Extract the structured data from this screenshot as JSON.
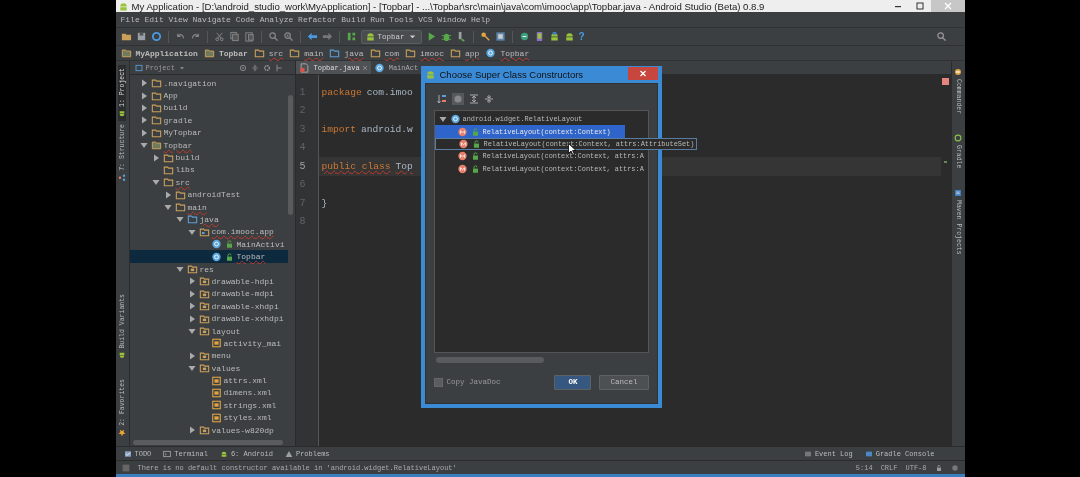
{
  "window": {
    "title": "My Application - [D:\\android_studio_work\\MyApplication] - [Topbar] - ...\\Topbar\\src\\main\\java\\com\\imooc\\app\\Topbar.java - Android Studio (Beta) 0.8.9"
  },
  "menu_titles": [
    "File",
    "Edit",
    "View",
    "Navigate",
    "Code",
    "Analyze",
    "Refactor",
    "Build",
    "Run",
    "Tools",
    "VCS",
    "Window",
    "Help"
  ],
  "toolbar": {
    "run_config": "Topbar",
    "help": "?"
  },
  "breadcrumbs": [
    {
      "label": "MyApplication",
      "kind": "module",
      "error": false
    },
    {
      "label": "Topbar",
      "kind": "module",
      "error": false
    },
    {
      "label": "src",
      "kind": "folder",
      "error": true
    },
    {
      "label": "main",
      "kind": "folder",
      "error": true
    },
    {
      "label": "java",
      "kind": "source",
      "error": true
    },
    {
      "label": "com",
      "kind": "folder",
      "error": true
    },
    {
      "label": "imooc",
      "kind": "folder",
      "error": true
    },
    {
      "label": "app",
      "kind": "folder",
      "error": true
    },
    {
      "label": "Topbar",
      "kind": "class",
      "error": true
    }
  ],
  "side_tabs_left": {
    "top": [
      {
        "label": "1: Project",
        "selected": true,
        "kind": "android"
      },
      {
        "label": "7: Structure",
        "selected": false,
        "kind": "structure"
      }
    ],
    "bottom": [
      {
        "label": "Build Variants",
        "selected": false,
        "kind": "android"
      },
      {
        "label": "2: Favorites",
        "selected": false,
        "kind": "star"
      }
    ]
  },
  "project_panel": {
    "title": "Project",
    "tree": [
      {
        "label": ".navigation",
        "kind": "folder",
        "expanded": false,
        "selected": false,
        "error": false
      },
      {
        "label": "App",
        "kind": "folder",
        "expanded": false,
        "selected": false,
        "error": false
      },
      {
        "label": "build",
        "kind": "folder",
        "expanded": false,
        "selected": false,
        "error": false
      },
      {
        "label": "gradle",
        "kind": "folder",
        "expanded": false,
        "selected": false,
        "error": false
      },
      {
        "label": "MyTopbar",
        "kind": "folder",
        "expanded": false,
        "selected": false,
        "error": false
      },
      {
        "label": "Topbar",
        "kind": "module",
        "expanded": true,
        "selected": false,
        "error": true,
        "children": [
          {
            "label": "build",
            "kind": "folder",
            "expanded": false,
            "selected": false,
            "error": false
          },
          {
            "label": "libs",
            "kind": "folder",
            "selected": false,
            "error": false
          },
          {
            "label": "src",
            "kind": "folder",
            "expanded": true,
            "selected": false,
            "error": true,
            "children": [
              {
                "label": "androidTest",
                "kind": "folder",
                "expanded": false,
                "selected": false,
                "error": false
              },
              {
                "label": "main",
                "kind": "folder",
                "expanded": true,
                "selected": false,
                "error": true,
                "children": [
                  {
                    "label": "java",
                    "kind": "source",
                    "expanded": true,
                    "selected": false,
                    "error": true,
                    "children": [
                      {
                        "label": "com.imooc.app",
                        "kind": "package",
                        "expanded": true,
                        "selected": false,
                        "error": true,
                        "children": [
                          {
                            "label": "MainActivi",
                            "kind": "class",
                            "selected": false,
                            "error": false
                          },
                          {
                            "label": "Topbar",
                            "kind": "class",
                            "selected": true,
                            "error": true
                          }
                        ]
                      }
                    ]
                  },
                  {
                    "label": "res",
                    "kind": "resource",
                    "expanded": true,
                    "selected": false,
                    "error": false,
                    "children": [
                      {
                        "label": "drawable-hdpi",
                        "kind": "resource",
                        "expanded": false,
                        "selected": false,
                        "error": false
                      },
                      {
                        "label": "drawable-mdpi",
                        "kind": "resource",
                        "expanded": false,
                        "selected": false,
                        "error": false
                      },
                      {
                        "label": "drawable-xhdpi",
                        "kind": "resource",
                        "expanded": false,
                        "selected": false,
                        "error": false
                      },
                      {
                        "label": "drawable-xxhdpi",
                        "kind": "resource",
                        "expanded": false,
                        "selected": false,
                        "error": false
                      },
                      {
                        "label": "layout",
                        "kind": "resource",
                        "expanded": true,
                        "selected": false,
                        "error": false,
                        "children": [
                          {
                            "label": "activity_mai",
                            "kind": "xml",
                            "selected": false,
                            "error": false
                          }
                        ]
                      },
                      {
                        "label": "menu",
                        "kind": "resource",
                        "expanded": false,
                        "selected": false,
                        "error": false
                      },
                      {
                        "label": "values",
                        "kind": "resource",
                        "expanded": true,
                        "selected": false,
                        "error": false,
                        "children": [
                          {
                            "label": "attrs.xml",
                            "kind": "xml",
                            "selected": false,
                            "error": false
                          },
                          {
                            "label": "dimens.xml",
                            "kind": "xml",
                            "selected": false,
                            "error": false
                          },
                          {
                            "label": "strings.xml",
                            "kind": "xml",
                            "selected": false,
                            "error": false
                          },
                          {
                            "label": "styles.xml",
                            "kind": "xml",
                            "selected": false,
                            "error": false
                          }
                        ]
                      },
                      {
                        "label": "values-w820dp",
                        "kind": "resource",
                        "expanded": false,
                        "selected": false,
                        "error": false
                      }
                    ]
                  }
                ]
              }
            ]
          }
        ]
      }
    ]
  },
  "editor": {
    "tabs": [
      {
        "label": "Topbar.java",
        "kind": "file",
        "selected": true
      },
      {
        "label": "MainAct",
        "kind": "class",
        "selected": false
      }
    ],
    "lines": [
      {
        "number": "1",
        "current": false,
        "tokens": [
          {
            "text": "package",
            "kind": "keyword",
            "error": false
          },
          {
            "text": "com.imoo",
            "kind": "plain",
            "error": false
          }
        ]
      },
      {
        "number": "2",
        "current": false
      },
      {
        "number": "3",
        "current": false,
        "tokens": [
          {
            "text": "import",
            "kind": "keyword",
            "error": false
          },
          {
            "text": "android.w",
            "kind": "plain",
            "error": false
          }
        ]
      },
      {
        "number": "4",
        "current": false
      },
      {
        "number": "5",
        "current": true,
        "tokens": [
          {
            "text": "public class",
            "kind": "keyword",
            "error": true
          },
          {
            "text": "Top",
            "kind": "plain",
            "error": true
          }
        ]
      },
      {
        "number": "6",
        "current": false
      },
      {
        "number": "7",
        "current": false,
        "tokens": [
          {
            "text": "}",
            "kind": "plain",
            "error": false
          }
        ]
      },
      {
        "number": "8",
        "current": false
      }
    ]
  },
  "side_tabs_right": [
    {
      "label": "Commander",
      "selected": false,
      "kind": "commander"
    },
    {
      "label": "Gradle",
      "selected": false,
      "kind": "gradle"
    },
    {
      "label": "Maven Projects",
      "selected": false,
      "kind": "maven"
    }
  ],
  "dialog": {
    "title": "Choose Super Class Constructors",
    "root": {
      "label": "android.widget.RelativeLayout",
      "expanded": true,
      "children": [
        {
          "label": "RelativeLayout(context:Context)",
          "selected": true,
          "hovered": false
        },
        {
          "label": "RelativeLayout(context:Context, attrs:AttributeSet)",
          "selected": false,
          "hovered": true
        },
        {
          "label": "RelativeLayout(context:Context, attrs:A",
          "selected": false,
          "hovered": false
        },
        {
          "label": "RelativeLayout(context:Context, attrs:A",
          "selected": false,
          "hovered": false
        }
      ]
    },
    "copy_javadoc": {
      "label": "Copy JavaDoc",
      "checked": false
    },
    "buttons": [
      {
        "label": "OK",
        "default": true
      },
      {
        "label": "Cancel",
        "default": false
      }
    ]
  },
  "tool_tabs": {
    "left": [
      {
        "label": "TODO",
        "kind": "todo"
      },
      {
        "label": "Terminal",
        "kind": "terminal"
      },
      {
        "label": "6: Android",
        "kind": "android"
      },
      {
        "label": "Problems",
        "kind": "problems"
      }
    ],
    "right": [
      {
        "label": "Event Log",
        "kind": "log"
      },
      {
        "label": "Gradle Console",
        "kind": "console"
      }
    ]
  },
  "status_bar": {
    "message": "There is no default constructor available in 'android.widget.RelativeLayout'",
    "position": "5:14",
    "line_separator": "CRLF",
    "encoding": "UTF-8"
  }
}
